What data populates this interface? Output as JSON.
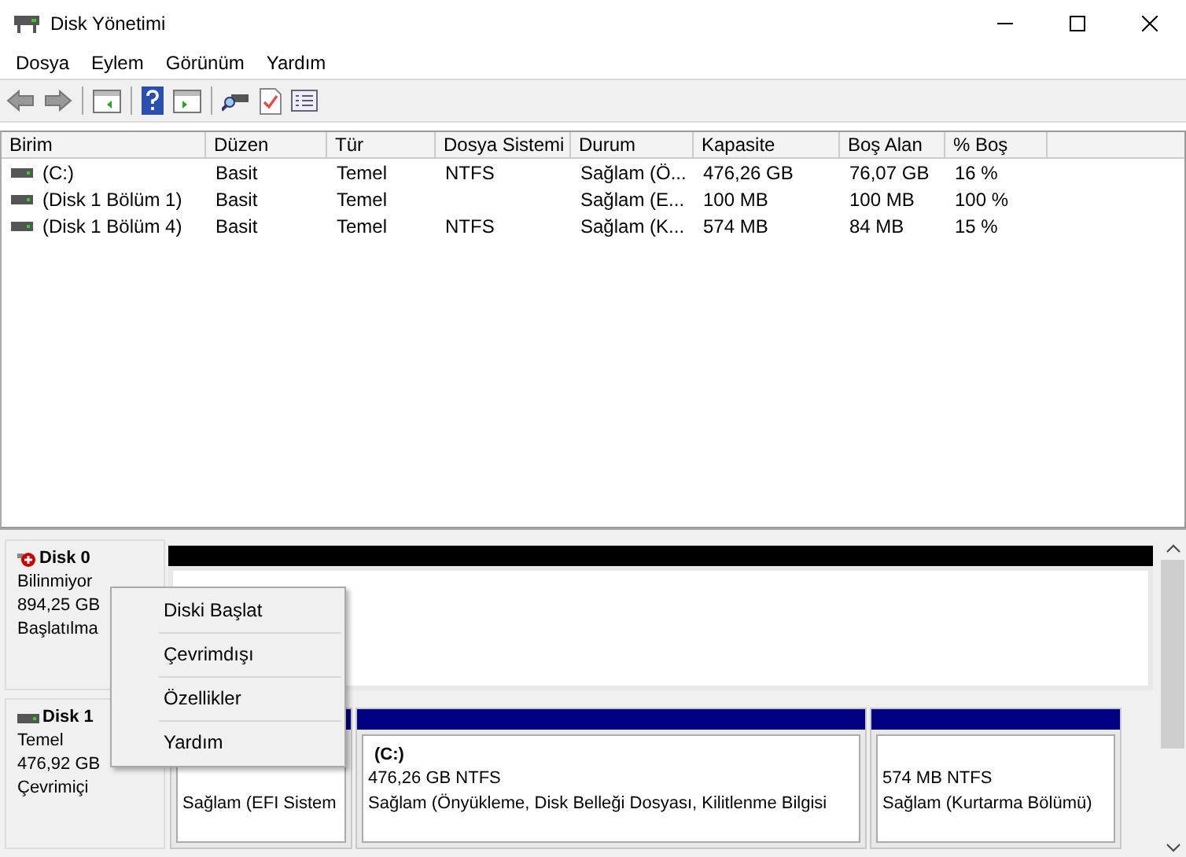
{
  "window": {
    "title": "Disk Yönetimi"
  },
  "menu": [
    "Dosya",
    "Eylem",
    "Görünüm",
    "Yardım"
  ],
  "table": {
    "columns": [
      "Birim",
      "Düzen",
      "Tür",
      "Dosya Sistemi",
      "Durum",
      "Kapasite",
      "Boş Alan",
      "% Boş"
    ],
    "rows": [
      {
        "cells": [
          "(C:)",
          "Basit",
          "Temel",
          "NTFS",
          "Sağlam (Ö...",
          "476,26 GB",
          "76,07 GB",
          "16 %"
        ]
      },
      {
        "cells": [
          "(Disk 1 Bölüm 1)",
          "Basit",
          "Temel",
          "",
          "Sağlam (E...",
          "100 MB",
          "100 MB",
          "100 %"
        ]
      },
      {
        "cells": [
          "(Disk 1 Bölüm 4)",
          "Basit",
          "Temel",
          "NTFS",
          "Sağlam (K...",
          "574 MB",
          "84 MB",
          "15 %"
        ]
      }
    ]
  },
  "disks": [
    {
      "name": "Disk 0",
      "kind": "unknown",
      "lines": [
        "Bilinmiyor",
        "894,25 GB",
        "Başlatılma"
      ]
    },
    {
      "name": "Disk 1",
      "kind": "online",
      "lines": [
        "Temel",
        "476,92 GB",
        "Çevrimiçi"
      ],
      "partitions": [
        {
          "lines": [
            "Sağlam (EFI Sistem"
          ]
        },
        {
          "title": "(C:)",
          "lines": [
            "476,26 GB NTFS",
            "Sağlam (Önyükleme, Disk Belleği Dosyası, Kilitlenme Bilgisi"
          ]
        },
        {
          "lines": [
            "574 MB NTFS",
            "Sağlam (Kurtarma Bölümü)"
          ]
        }
      ]
    }
  ],
  "context_menu": [
    "Diski Başlat",
    "Çevrimdışı",
    "Özellikler",
    "Yardım"
  ]
}
